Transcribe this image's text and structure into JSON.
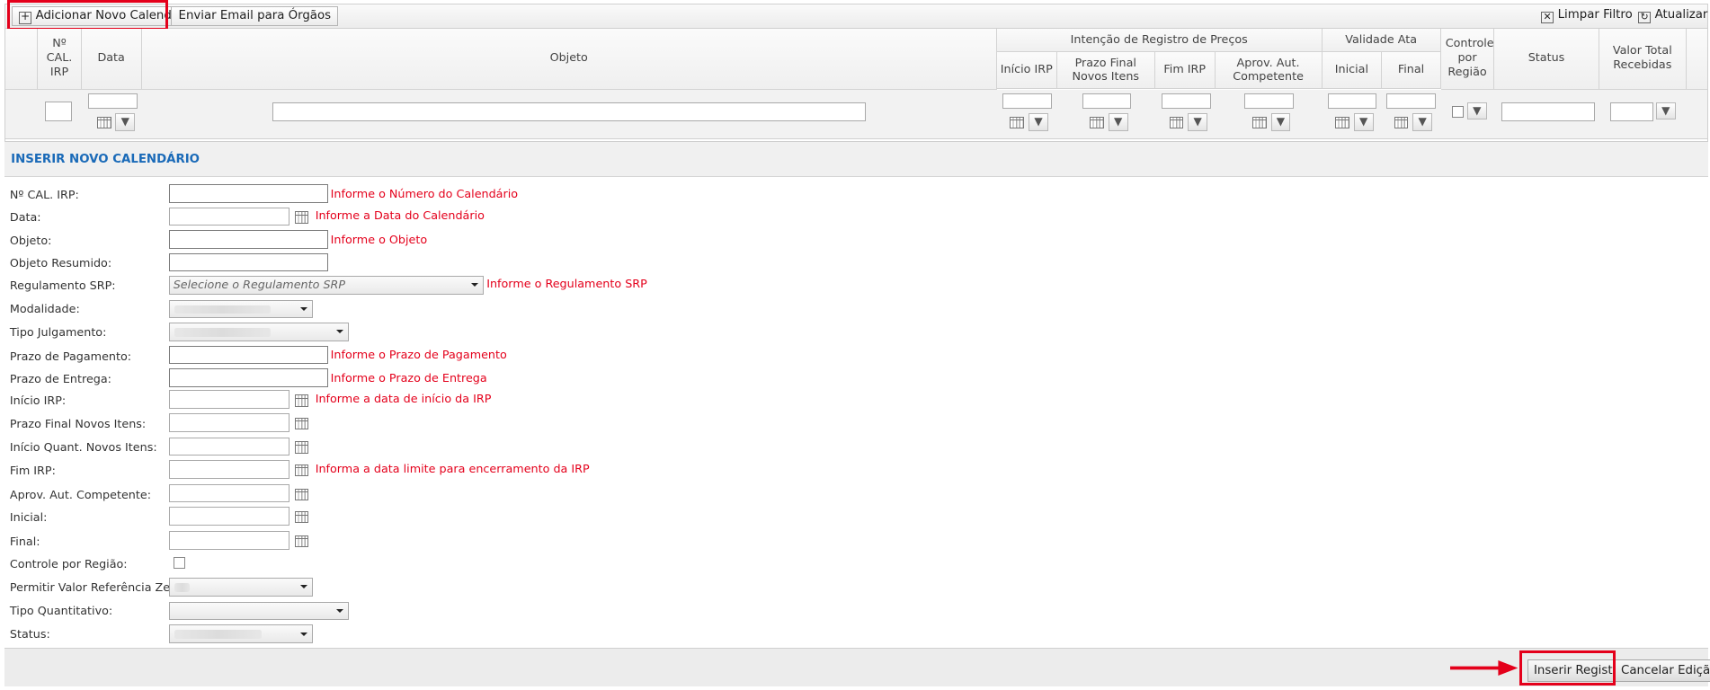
{
  "toolbar": {
    "add_calendar": "Adicionar Novo Calendário",
    "send_email": "Enviar Email para Órgãos",
    "clear_filter": "Limpar Filtro",
    "refresh": "Atualizar"
  },
  "grid": {
    "columns": {
      "num": "Nº CAL. IRP",
      "data": "Data",
      "objeto": "Objeto",
      "group_irp": "Intenção de Registro de Preços",
      "inicio_irp": "Início IRP",
      "prazo_final": "Prazo Final Novos Itens",
      "fim_irp": "Fim IRP",
      "aprov": "Aprov. Aut. Competente",
      "group_validade": "Validade Ata",
      "inicial": "Inicial",
      "final": "Final",
      "controle": "Controle por Região",
      "status": "Status",
      "valor_total": "Valor Total Recebidas"
    }
  },
  "form": {
    "section_title": "INSERIR NOVO CALENDÁRIO",
    "fields": {
      "num_cal": {
        "label": "Nº CAL. IRP:",
        "msg": "Informe o Número do Calendário"
      },
      "data": {
        "label": "Data:",
        "msg": "Informe a Data do Calendário"
      },
      "objeto": {
        "label": "Objeto:",
        "msg": "Informe o Objeto"
      },
      "objeto_resumido": {
        "label": "Objeto Resumido:"
      },
      "regulamento": {
        "label": "Regulamento SRP:",
        "placeholder": "Selecione o Regulamento SRP",
        "msg": "Informe o Regulamento SRP"
      },
      "modalidade": {
        "label": "Modalidade:"
      },
      "tipo_julgamento": {
        "label": "Tipo Julgamento:"
      },
      "prazo_pagamento": {
        "label": "Prazo de Pagamento:",
        "msg": "Informe o Prazo de Pagamento"
      },
      "prazo_entrega": {
        "label": "Prazo de Entrega:",
        "msg": "Informe o Prazo de Entrega"
      },
      "inicio_irp": {
        "label": "Início IRP:",
        "msg": "Informe a data de início da IRP"
      },
      "prazo_final": {
        "label": "Prazo Final Novos Itens:"
      },
      "inicio_quant": {
        "label": "Início Quant. Novos Itens:"
      },
      "fim_irp": {
        "label": "Fim IRP:",
        "msg": "Informa a data limite para encerramento da IRP"
      },
      "aprov": {
        "label": "Aprov. Aut. Competente:"
      },
      "inicial": {
        "label": "Inicial:"
      },
      "final": {
        "label": "Final:"
      },
      "controle": {
        "label": "Controle por Região:"
      },
      "permitir": {
        "label": "Permitir Valor Referência Zerado:"
      },
      "tipo_quant": {
        "label": "Tipo Quantitativo:"
      },
      "status": {
        "label": "Status:"
      }
    }
  },
  "footer": {
    "insert": "Inserir Registro",
    "cancel": "Cancelar Edição"
  },
  "colors": {
    "accent_red": "#e4001b",
    "section_blue": "#1a6ab8"
  }
}
